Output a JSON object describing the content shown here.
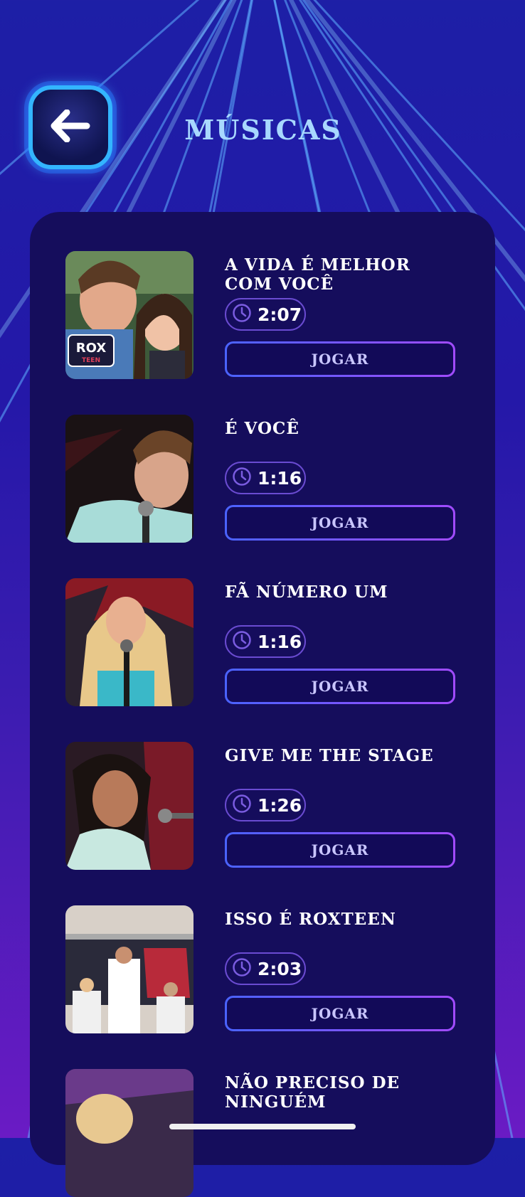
{
  "header": {
    "title": "MÚSICAS"
  },
  "songs": [
    {
      "title": "A VIDA É MELHOR COM VOCÊ",
      "duration": "2:07",
      "play_label": "JOGAR"
    },
    {
      "title": "É VOCÊ",
      "duration": "1:16",
      "play_label": "JOGAR"
    },
    {
      "title": "FÃ NÚMERO UM",
      "duration": "1:16",
      "play_label": "JOGAR"
    },
    {
      "title": "GIVE ME THE STAGE",
      "duration": "1:26",
      "play_label": "JOGAR"
    },
    {
      "title": "ISSO É ROXTEEN",
      "duration": "2:03",
      "play_label": "JOGAR"
    },
    {
      "title": "NÃO PRECISO DE NINGUÉM",
      "duration": "",
      "play_label": ""
    }
  ],
  "thumb_badge": {
    "line1": "ROX",
    "line2": "TEEN"
  },
  "icons": {
    "back": "arrow-left-icon",
    "duration": "clock-icon"
  },
  "colors": {
    "background_top": "#1d1fa6",
    "background_bottom": "#6a1bc4",
    "panel": "#150d5c",
    "title": "#a8d8ff",
    "back_border": "#33b5ff",
    "button_gradient_start": "#4a63ff",
    "button_gradient_end": "#a14bff"
  }
}
